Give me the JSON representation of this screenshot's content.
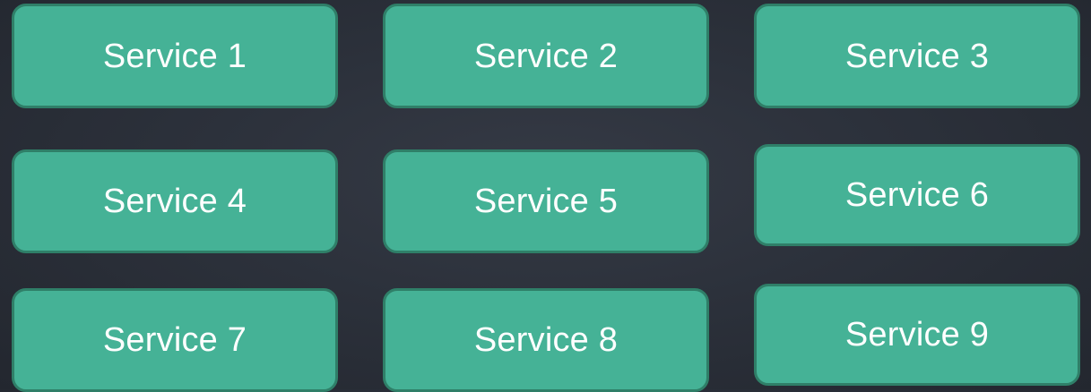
{
  "services": [
    {
      "label": "Service 1"
    },
    {
      "label": "Service 2"
    },
    {
      "label": "Service 3"
    },
    {
      "label": "Service 4"
    },
    {
      "label": "Service 5"
    },
    {
      "label": "Service 6"
    },
    {
      "label": "Service 7"
    },
    {
      "label": "Service 8"
    },
    {
      "label": "Service 9"
    }
  ],
  "colors": {
    "box_fill": "#45b296",
    "box_border": "#2f7f68",
    "label_text": "#ffffff",
    "background": "#2c313b"
  }
}
